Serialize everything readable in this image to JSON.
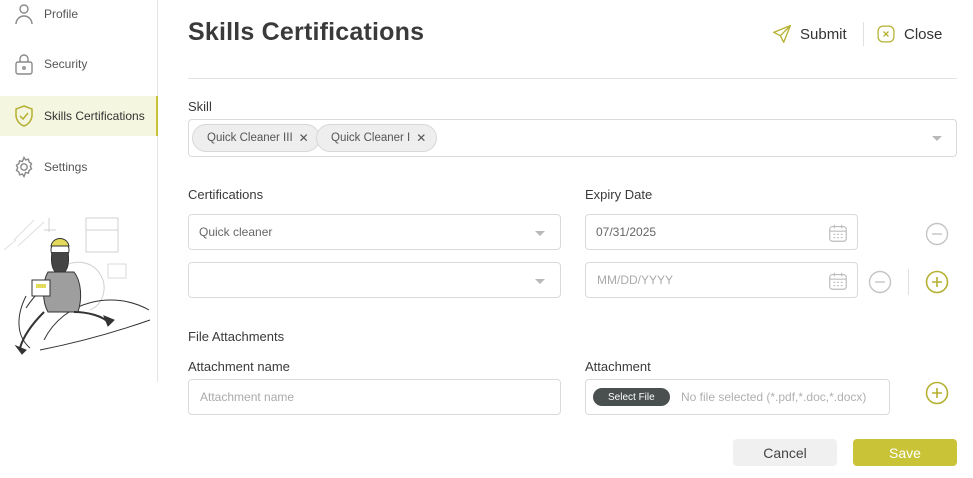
{
  "sidebar": {
    "items": [
      {
        "label": "Profile",
        "icon": "user-icon"
      },
      {
        "label": "Security",
        "icon": "lock-icon"
      },
      {
        "label": "Skills Certifications",
        "icon": "shield-check-icon",
        "active": true
      },
      {
        "label": "Settings",
        "icon": "gear-icon"
      }
    ]
  },
  "header": {
    "title": "Skills Certifications",
    "submit_label": "Submit",
    "close_label": "Close"
  },
  "skill": {
    "label": "Skill",
    "chips": [
      "Quick Cleaner III",
      "Quick Cleaner I"
    ]
  },
  "certifications": {
    "label": "Certifications",
    "rows": [
      {
        "value": "Quick cleaner"
      },
      {
        "value": ""
      }
    ]
  },
  "expiry": {
    "label": "Expiry Date",
    "rows": [
      {
        "value": "07/31/2025"
      },
      {
        "placeholder": "MM/DD/YYYY"
      }
    ]
  },
  "files": {
    "section_label": "File Attachments",
    "name_label": "Attachment name",
    "name_placeholder": "Attachment name",
    "attachment_label": "Attachment",
    "select_file_label": "Select File",
    "no_file_text": "No file selected (*.pdf,*.doc,*.docx)"
  },
  "footer": {
    "cancel_label": "Cancel",
    "save_label": "Save"
  },
  "colors": {
    "accent": "#c9c437",
    "active_bg": "#f4f6df",
    "dark_button": "#4a4f50"
  }
}
